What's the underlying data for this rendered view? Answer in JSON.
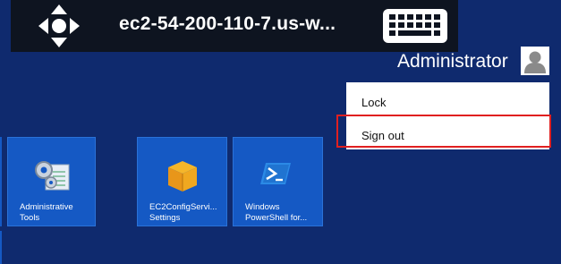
{
  "toolbar": {
    "session_title": "ec2-54-200-110-7.us-w...",
    "move_icon": "move-arrows-icon",
    "keyboard_icon": "keyboard-icon"
  },
  "user": {
    "name": "Administrator",
    "avatar_icon": "user-avatar-icon"
  },
  "menu": {
    "items": [
      {
        "label": "Lock"
      },
      {
        "label": "Sign out",
        "highlighted": true
      }
    ],
    "highlight_color": "#e02020"
  },
  "tiles": [
    {
      "label_line1": "Administrative",
      "label_line2": "Tools",
      "icon": "gears-icon"
    },
    {
      "label_line1": "EC2ConfigServi...",
      "label_line2": "Settings",
      "icon": "ec2-box-icon"
    },
    {
      "label_line1": "Windows",
      "label_line2": "PowerShell for...",
      "icon": "powershell-icon"
    }
  ],
  "colors": {
    "background": "#0f2a6e",
    "tile": "#1559c4",
    "toolbar": "#0e1420"
  }
}
